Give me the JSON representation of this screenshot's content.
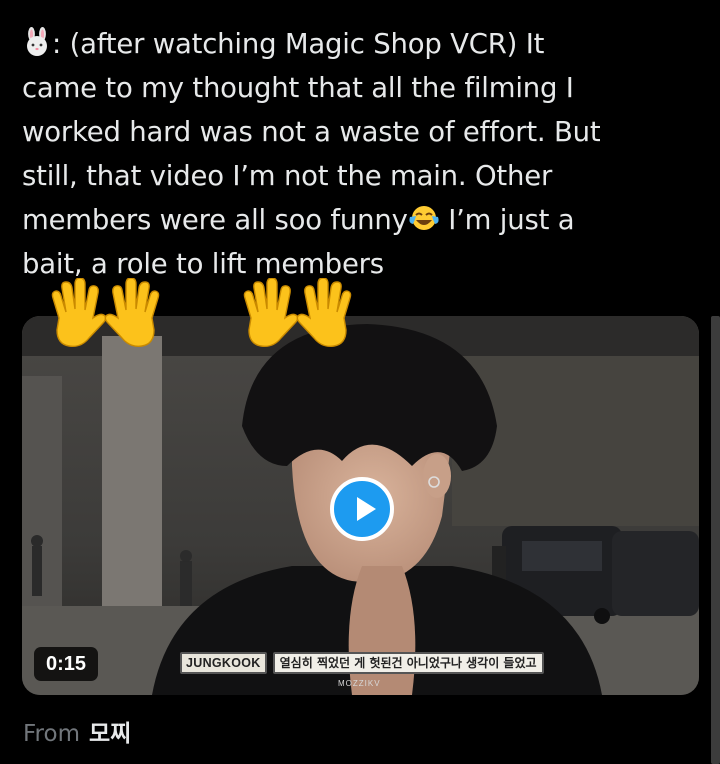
{
  "tweet": {
    "lines": [
      ": (after watching Magic Shop VCR) It",
      "came to my thought that all the filming I",
      "worked hard was not a waste of effort. But",
      "still, that video I’m not the main. Other",
      "members were all soo funny",
      " I’m just a",
      "bait, a role to lift members"
    ],
    "icons": [
      "rabbit-face-emoji",
      "tears-of-joy-emoji",
      "waving-hand-emoji"
    ]
  },
  "video": {
    "duration": "0:15",
    "subtitle_name": "JUNGKOOK",
    "subtitle_text": "열심히 찍었던 게 헛된건 아니었구나 생각이 들었고",
    "watermark": "MOZZIKV"
  },
  "source": {
    "prefix": "From",
    "name": "모찌"
  },
  "colors": {
    "background": "#000000",
    "text": "#e7e9ea",
    "muted": "#71767b",
    "accent": "#1d9bf0"
  }
}
